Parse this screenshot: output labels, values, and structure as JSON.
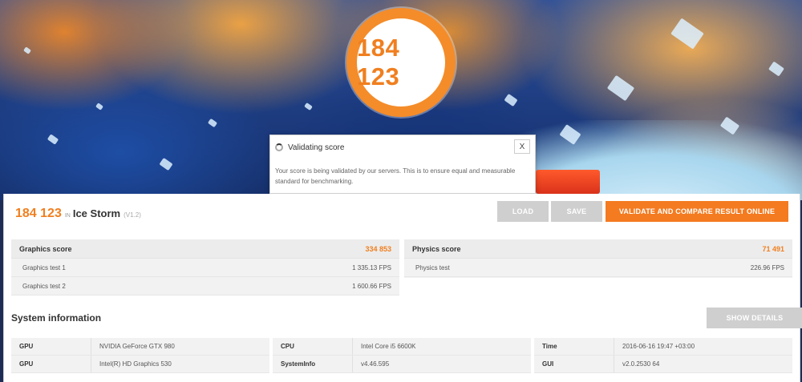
{
  "hero": {
    "score": "184 123"
  },
  "dialog": {
    "title": "Validating score",
    "close_label": "X",
    "message": "Your score is being validated by our servers. This is to ensure equal and measurable standard for benchmarking."
  },
  "result": {
    "score": "184 123",
    "in_label": "IN",
    "benchmark": "Ice Storm",
    "version": "(V1.2)"
  },
  "buttons": {
    "load": "LOAD",
    "save": "SAVE",
    "validate": "VALIDATE AND COMPARE RESULT ONLINE",
    "show_details": "SHOW DETAILS"
  },
  "graphics": {
    "label": "Graphics score",
    "value": "334 853",
    "tests": [
      {
        "name": "Graphics test 1",
        "value": "1 335.13 FPS"
      },
      {
        "name": "Graphics test 2",
        "value": "1 600.66 FPS"
      }
    ]
  },
  "physics": {
    "label": "Physics score",
    "value": "71 491",
    "tests": [
      {
        "name": "Physics test",
        "value": "226.96 FPS"
      }
    ]
  },
  "system": {
    "title": "System information",
    "columns": [
      [
        {
          "key": "GPU",
          "value": "NVIDIA GeForce GTX 980"
        },
        {
          "key": "GPU",
          "value": "Intel(R) HD Graphics 530"
        }
      ],
      [
        {
          "key": "CPU",
          "value": "Intel Core i5 6600K"
        },
        {
          "key": "SystemInfo",
          "value": "v4.46.595"
        }
      ],
      [
        {
          "key": "Time",
          "value": "2016-06-16 19:47 +03:00"
        },
        {
          "key": "GUI",
          "value": "v2.0.2530 64"
        }
      ]
    ]
  },
  "colors": {
    "accent": "#f47b20",
    "button_grey": "#cfcfcf"
  }
}
